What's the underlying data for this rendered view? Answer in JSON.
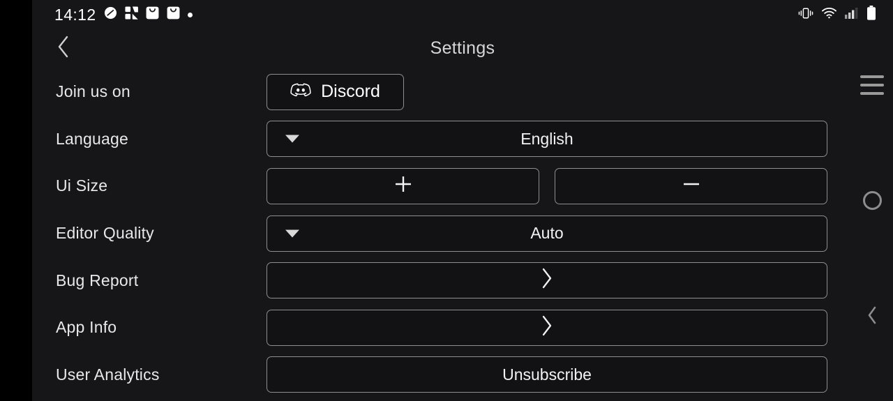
{
  "statusbar": {
    "clock": "14:12",
    "left_icons": [
      {
        "name": "do-not-disturb-icon"
      },
      {
        "name": "app-puzzle-icon"
      },
      {
        "name": "shopping-bag-icon"
      },
      {
        "name": "shopping-bag-icon-2"
      },
      {
        "name": "dot-indicator-icon"
      }
    ],
    "right_icons": [
      {
        "name": "vibrate-icon"
      },
      {
        "name": "wifi-icon"
      },
      {
        "name": "cellular-signal-icon"
      },
      {
        "name": "battery-icon"
      }
    ]
  },
  "header": {
    "title": "Settings",
    "back_icon": "chevron-left-icon"
  },
  "settings": {
    "rows": [
      {
        "label": "Join us on",
        "control": "discord",
        "button_label": "Discord",
        "icon": "discord-logo-icon"
      },
      {
        "label": "Language",
        "control": "dropdown",
        "value": "English",
        "icon": "chevron-down-icon"
      },
      {
        "label": "Ui Size",
        "control": "stepper",
        "increase_label": "+",
        "decrease_label": "—",
        "increase_icon": "plus-icon",
        "decrease_icon": "minus-icon"
      },
      {
        "label": "Editor Quality",
        "control": "dropdown",
        "value": "Auto",
        "icon": "chevron-down-icon"
      },
      {
        "label": "Bug Report",
        "control": "navigate",
        "value": "",
        "icon": "chevron-right-icon"
      },
      {
        "label": "App Info",
        "control": "navigate",
        "value": "",
        "icon": "chevron-right-icon"
      },
      {
        "label": "User Analytics",
        "control": "action",
        "value": "Unsubscribe"
      }
    ]
  },
  "system_nav": {
    "menu_icon": "hamburger-menu-icon",
    "home_icon": "home-circle-icon",
    "back_icon": "chevron-left-icon"
  },
  "colors": {
    "page_background": "#161618",
    "gutter": "#000000",
    "button_fill": "#121214",
    "button_border": "#8e8e8e",
    "text_primary": "#e8e8e8",
    "title": "#d6d6d6",
    "sysnav": "#9a9a9a"
  }
}
